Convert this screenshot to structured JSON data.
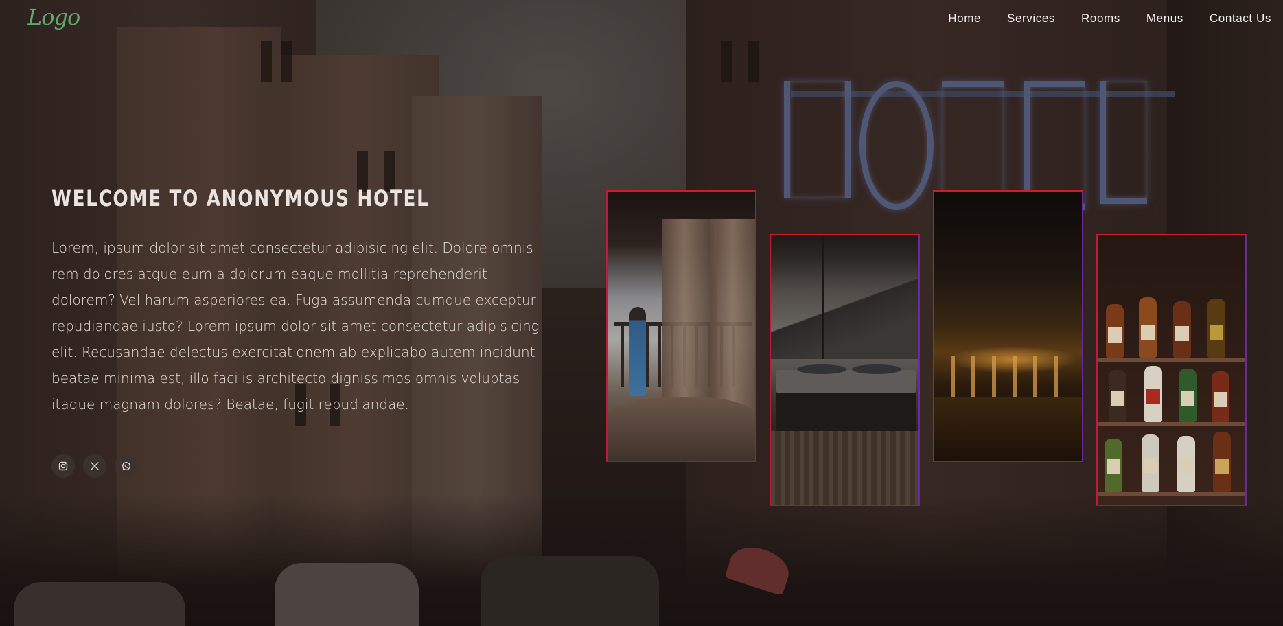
{
  "brand": {
    "logo_text": "Logo",
    "accent": "#5fa86b"
  },
  "nav": {
    "items": [
      {
        "label": "Home"
      },
      {
        "label": "Services"
      },
      {
        "label": "Rooms"
      },
      {
        "label": "Menus"
      },
      {
        "label": "Contact Us"
      }
    ]
  },
  "hero": {
    "title": "WELCOME TO ANONYMOUS HOTEL",
    "body": "Lorem, ipsum dolor sit amet consectetur adipisicing elit. Dolore omnis rem dolores atque eum a dolorum eaque mollitia reprehenderit dolorem? Vel harum asperiores ea. Fuga assumenda cumque excepturi repudiandae iusto? Lorem ipsum dolor sit amet consectetur adipisicing elit. Recusandae delectus exercitationem ab explicabo autem incidunt beatae minima est, illo facilis architecto dignissimos omnis voluptas itaque magnam dolores? Beatae, fugit repudiandae."
  },
  "socials": [
    {
      "icon": "instagram-icon"
    },
    {
      "icon": "x-twitter-icon"
    },
    {
      "icon": "whatsapp-icon"
    }
  ],
  "gallery": [
    {
      "subject": "balcony-bedroom"
    },
    {
      "subject": "bedroom-window"
    },
    {
      "subject": "bar-lounge"
    },
    {
      "subject": "liquor-bottles-shelf"
    }
  ],
  "colors": {
    "card_border_top": "#d11a2a",
    "card_border_bottom": "#2a3ad6",
    "text": "#e2dcd8"
  }
}
